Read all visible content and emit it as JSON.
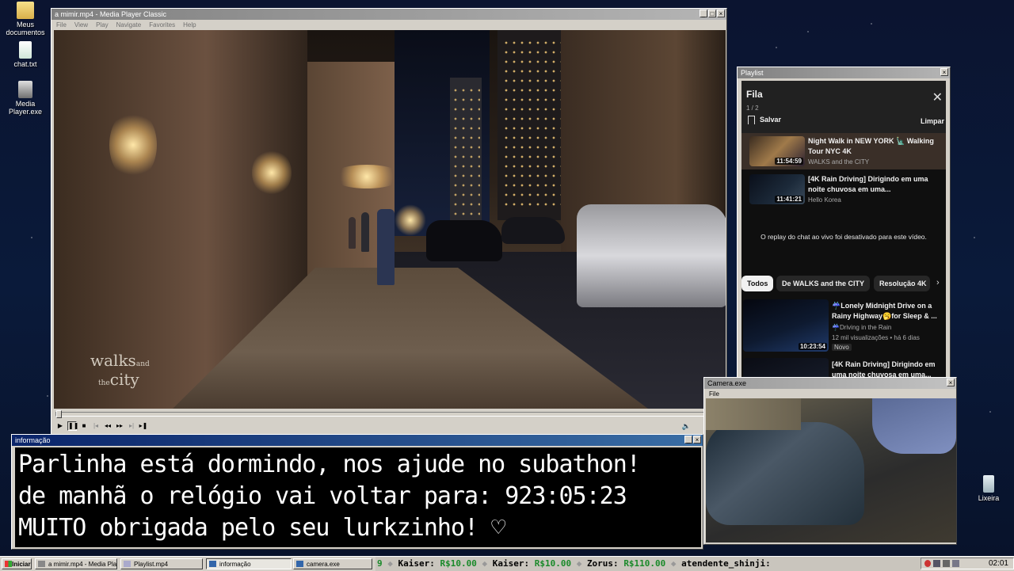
{
  "desktop": {
    "icons": [
      {
        "label": "Meus documentos",
        "icon": "folder-icon"
      },
      {
        "label": "chat.txt",
        "icon": "text-file-icon"
      },
      {
        "label": "Media Player.exe",
        "icon": "media-player-icon"
      },
      {
        "label": "Lixeira",
        "icon": "recycle-bin-icon"
      }
    ]
  },
  "player": {
    "title": "a mimir.mp4 - Media Player Classic",
    "menu": [
      "File",
      "View",
      "Play",
      "Navigate",
      "Favorites",
      "Help"
    ],
    "watermark_main": "walks",
    "watermark_and": "and",
    "watermark_the": "the",
    "watermark_city": "city",
    "seek_position": 0.0
  },
  "playlist": {
    "title": "Playlist",
    "header": "Fila",
    "count": "1 / 2",
    "save_label": "Salvar",
    "clear_label": "Limpar",
    "queue": [
      {
        "title": "Night Walk in NEW YORK 🗽 Walking Tour NYC 4K",
        "channel": "WALKS and the CITY",
        "duration": "11:54:59",
        "selected": true
      },
      {
        "title": "[4K Rain Driving] Dirigindo em uma noite chuvosa em uma...",
        "channel": "Hello Korea",
        "duration": "11:41:21",
        "selected": false
      }
    ],
    "chat_notice": "O replay do chat ao vivo foi desativado para este vídeo.",
    "chips": [
      "Todos",
      "De WALKS and the CITY",
      "Resolução 4K"
    ],
    "recommendations": [
      {
        "title": "☔Lonely Midnight Drive on a Rainy Highway🥱for Sleep & ...",
        "channel": "☔Driving in the Rain",
        "meta": "12 mil visualizações • há 6 dias",
        "badge": "Novo",
        "duration": "10:23:54"
      },
      {
        "title": "[4K Rain Driving] Dirigindo em uma noite chuvosa em uma...",
        "channel": "",
        "meta": "",
        "badge": "",
        "duration": ""
      }
    ]
  },
  "info": {
    "title": "informação",
    "lines": [
      "Parlinha está dormindo, nos ajude no subathon!",
      "de manhã o relógio vai voltar para:  923:05:23",
      "MUITO obrigada pelo seu lurkzinho! ♡"
    ]
  },
  "camera": {
    "title": "Camera.exe",
    "menu": [
      "File"
    ]
  },
  "taskbar": {
    "start": "Iniciar",
    "tasks": [
      {
        "label": "a mimir.mp4 - Media Playe...",
        "active": false
      },
      {
        "label": "Playlist.mp4",
        "active": false
      },
      {
        "label": "informação",
        "active": true
      },
      {
        "label": "camera.exe",
        "active": false
      }
    ],
    "ticker": [
      {
        "name": "9",
        "amount": ""
      },
      {
        "name": "Kaiser:",
        "amount": "R$10.00"
      },
      {
        "name": "Kaiser:",
        "amount": "R$10.00"
      },
      {
        "name": "Zorus:",
        "amount": "R$110.00"
      },
      {
        "name": "atendente_shinji:",
        "amount": ""
      }
    ],
    "clock": "02:01"
  },
  "colors": {
    "titlebar_active": "#0a246a",
    "ticker_amount": "#1a8a2a",
    "yt_bg": "#0f0f0f"
  }
}
